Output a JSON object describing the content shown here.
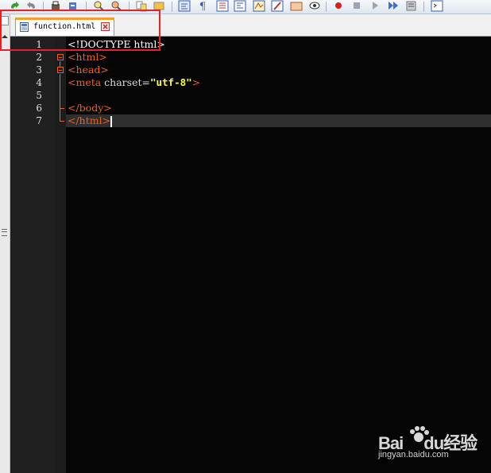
{
  "tab": {
    "label": "function.html"
  },
  "editor": {
    "lines": [
      {
        "number": "1",
        "text": "<!DOCTYPE html>"
      },
      {
        "number": "2",
        "text": "<html>"
      },
      {
        "number": "3",
        "text": "<head>"
      },
      {
        "number": "4",
        "text": "<meta charset=\"utf-8\">"
      },
      {
        "number": "5",
        "text": ""
      },
      {
        "number": "6",
        "text": "</body>"
      },
      {
        "number": "7",
        "text": "</html>"
      }
    ],
    "current_line": "7",
    "colors": {
      "tag": "#ee6020",
      "string": "#fff94a",
      "background": "#050505",
      "gutter": "#202020"
    }
  },
  "toolbar": {
    "icons": [
      "redo-icon",
      "undo-icon",
      "print-icon",
      "replace-icon",
      "zoom-in-icon",
      "zoom-out-icon",
      "sync-scroll-icon",
      "word-wrap-icon",
      "show-all-chars-icon",
      "indent-guide-icon",
      "function-list-icon",
      "doc-map-icon",
      "folder-workspace-icon",
      "monitor-icon",
      "record-macro-icon",
      "stop-record-icon",
      "play-macro-icon",
      "run-multiple-icon",
      "save-macro-icon",
      "run-icon"
    ]
  },
  "watermark": {
    "brand": "Bai\u0001du经验",
    "url": "jingyan.baidu.com"
  }
}
